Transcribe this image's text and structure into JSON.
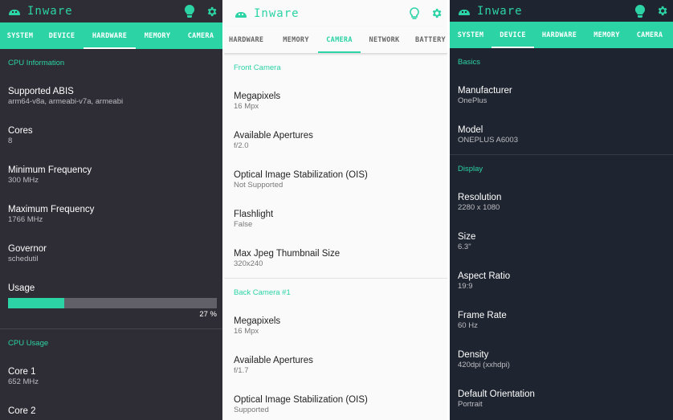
{
  "app": {
    "title": "Inware",
    "accent": "#2bd3a5",
    "icons": [
      "lightbulb-icon",
      "gear-icon",
      "android-logo-icon"
    ]
  },
  "panel1": {
    "tabs": [
      "SYSTEM",
      "DEVICE",
      "HARDWARE",
      "MEMORY",
      "CAMERA"
    ],
    "active_tab": "HARDWARE",
    "section1": "CPU Information",
    "items": [
      {
        "label": "Supported ABIS",
        "value": "arm64-v8a, armeabi-v7a, armeabi"
      },
      {
        "label": "Cores",
        "value": "8"
      },
      {
        "label": "Minimum Frequency",
        "value": "300 MHz"
      },
      {
        "label": "Maximum Frequency",
        "value": "1766 MHz"
      },
      {
        "label": "Governor",
        "value": "schedutil"
      }
    ],
    "usage": {
      "label": "Usage",
      "percent": 27,
      "text": "27 %"
    },
    "section2": "CPU Usage",
    "cores": [
      {
        "label": "Core 1",
        "value": "652 MHz"
      },
      {
        "label": "Core 2",
        "value": ""
      }
    ]
  },
  "panel2": {
    "tabs": [
      "HARDWARE",
      "MEMORY",
      "CAMERA",
      "NETWORK",
      "BATTERY"
    ],
    "active_tab": "CAMERA",
    "section1": "Front Camera",
    "front": [
      {
        "label": "Megapixels",
        "value": "16 Mpx"
      },
      {
        "label": "Available Apertures",
        "value": "f/2.0"
      },
      {
        "label": "Optical Image Stabilization (OIS)",
        "value": "Not Supported"
      },
      {
        "label": "Flashlight",
        "value": "False"
      },
      {
        "label": "Max Jpeg Thumbnail Size",
        "value": "320x240"
      }
    ],
    "section2": "Back Camera #1",
    "back": [
      {
        "label": "Megapixels",
        "value": "16 Mpx"
      },
      {
        "label": "Available Apertures",
        "value": "f/1.7"
      },
      {
        "label": "Optical Image Stabilization (OIS)",
        "value": "Supported"
      }
    ]
  },
  "panel3": {
    "tabs": [
      "SYSTEM",
      "DEVICE",
      "HARDWARE",
      "MEMORY",
      "CAMERA"
    ],
    "active_tab": "DEVICE",
    "section1": "Basics",
    "basics": [
      {
        "label": "Manufacturer",
        "value": "OnePlus"
      },
      {
        "label": "Model",
        "value": "ONEPLUS A6003"
      }
    ],
    "section2": "Display",
    "display": [
      {
        "label": "Resolution",
        "value": "2280 x 1080"
      },
      {
        "label": "Size",
        "value": "6.3\""
      },
      {
        "label": "Aspect Ratio",
        "value": "19:9"
      },
      {
        "label": "Frame Rate",
        "value": "60 Hz"
      },
      {
        "label": "Density",
        "value": "420dpi (xxhdpi)"
      },
      {
        "label": "Default Orientation",
        "value": "Portrait"
      }
    ]
  }
}
